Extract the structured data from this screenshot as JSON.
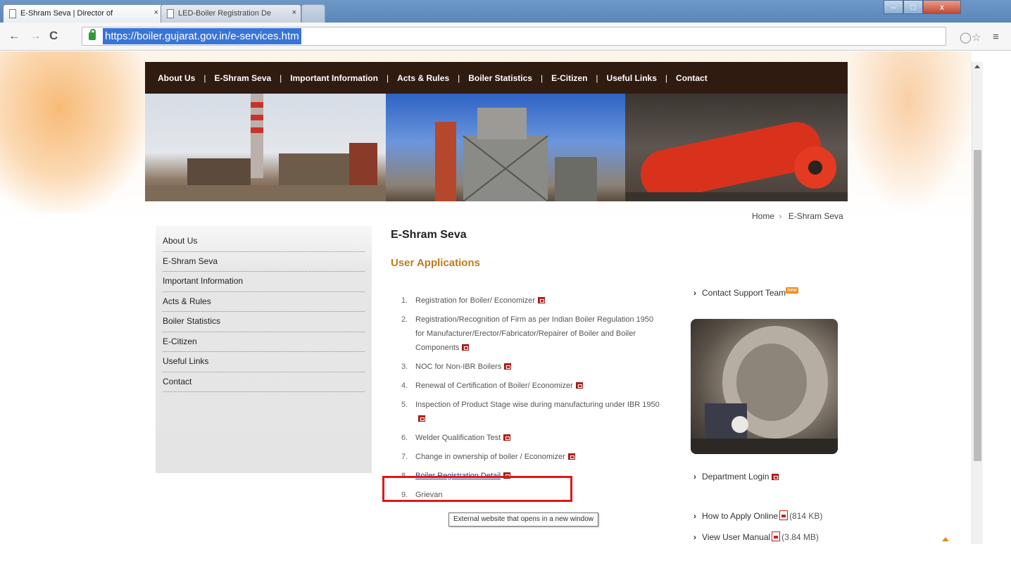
{
  "browser": {
    "tabs": [
      {
        "title": "E-Shram Seva | Director of",
        "close": "×",
        "active": true
      },
      {
        "title": "LED-Boiler Registration De",
        "close": "×",
        "active": false
      }
    ],
    "url": "https://boiler.gujarat.gov.in/e-services.htm",
    "window_buttons": {
      "minimize": "–",
      "maximize": "□",
      "close": "x"
    },
    "nav": {
      "back": "←",
      "forward": "→",
      "reload": "C"
    },
    "icons": {
      "shield": "shield-icon",
      "star": "star-icon",
      "menu": "menu-icon"
    }
  },
  "topnav": {
    "items": [
      "About Us",
      "E-Shram Seva",
      "Important Information",
      "Acts & Rules",
      "Boiler Statistics",
      "E-Citizen",
      "Useful Links",
      "Contact"
    ],
    "separator": "|"
  },
  "breadcrumb": {
    "home": "Home",
    "separator": "›",
    "current": "E-Shram Seva"
  },
  "sidebar": {
    "items": [
      "About Us",
      "E-Shram Seva",
      "Important Information",
      "Acts & Rules",
      "Boiler Statistics",
      "E-Citizen",
      "Useful Links",
      "Contact"
    ]
  },
  "main": {
    "title": "E-Shram Seva",
    "section_title": "User Applications",
    "applications": [
      {
        "num": "1.",
        "label": "Registration for Boiler/ Economizer"
      },
      {
        "num": "2.",
        "label": "Registration/Recognition of Firm as per Indian Boiler Regulation 1950 for Manufacturer/Erector/Fabricator/Repairer of Boiler and Boiler Components"
      },
      {
        "num": "3.",
        "label": "NOC for Non-IBR Boilers"
      },
      {
        "num": "4.",
        "label": "Renewal of Certification of Boiler/ Economizer"
      },
      {
        "num": "5.",
        "label": "Inspection of Product Stage wise during manufacturing under IBR 1950"
      },
      {
        "num": "6.",
        "label": "Welder Qualification Test"
      },
      {
        "num": "7.",
        "label": "Change in ownership of boiler / Economizer"
      },
      {
        "num": "8.",
        "label": "Boiler Registration Detail"
      },
      {
        "num": "9.",
        "label": "Grievan"
      }
    ],
    "tooltip": "External website that opens in a new window"
  },
  "right": {
    "contact_support": "Contact Support Team",
    "new_badge": "new",
    "department_login": "Department Login",
    "how_to_apply": "How to Apply Online",
    "how_to_apply_size": "(814 KB)",
    "user_manual": "View User Manual",
    "user_manual_size": "(3.84 MB)"
  },
  "colors": {
    "nav_bg": "#2f1b10",
    "section_title": "#c37b16",
    "highlight": "#e01818",
    "link": "#1f3a93"
  }
}
